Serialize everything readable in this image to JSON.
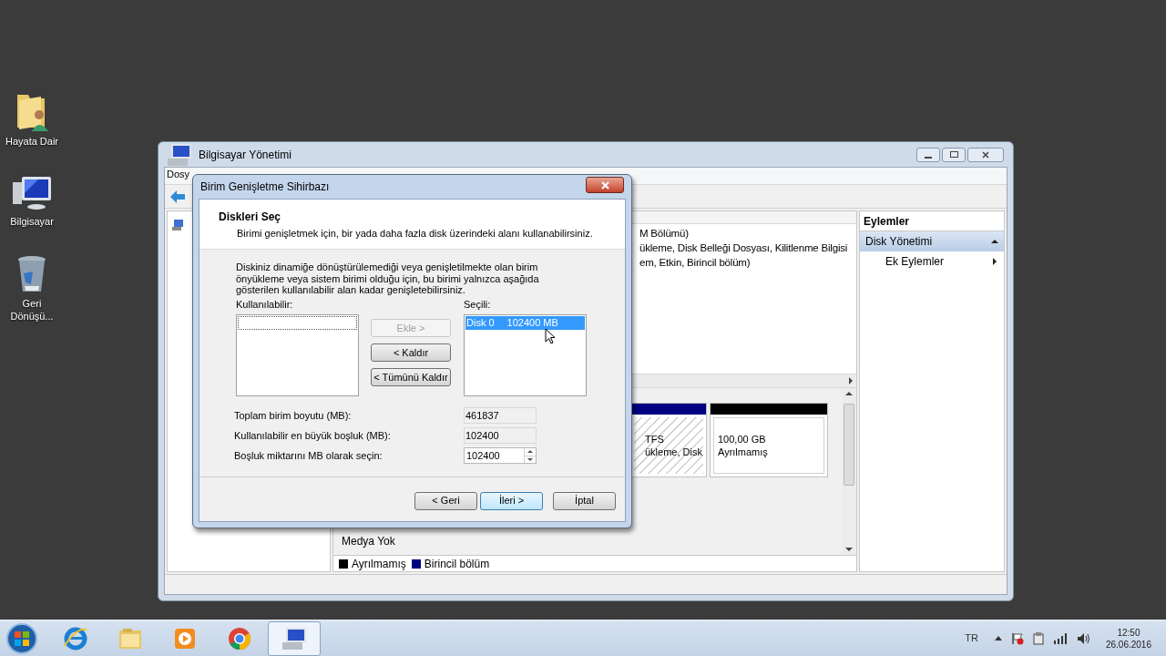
{
  "desktop_icons": [
    {
      "label": "Hayata Dair",
      "kind": "user-folder"
    },
    {
      "label": "Bilgisayar",
      "kind": "computer"
    },
    {
      "label": "Geri Dönüşü...",
      "kind": "recycle-bin"
    }
  ],
  "main_window": {
    "title": "Bilgisayar Yönetimi",
    "menu": [
      "Dosy"
    ],
    "volume_lines": [
      "M Bölümü)",
      "ükleme, Disk Belleği Dosyası, Kilitlenme Bilgisi",
      "em, Etkin, Birincil bölüm)"
    ],
    "partitions": [
      {
        "line1": "TFS",
        "line2": "ükleme, Disk",
        "color": "#000080",
        "kind": "primary"
      },
      {
        "line1": "100,00 GB",
        "line2": "Ayrılmamış",
        "color": "#000000",
        "kind": "unallocated"
      }
    ],
    "disk_rows": [
      {
        "label": "Medya Yok"
      }
    ],
    "legend": [
      {
        "label": "Ayrılmamış",
        "color": "#000000"
      },
      {
        "label": "Birincil bölüm",
        "color": "#000080"
      }
    ],
    "actions": {
      "header": "Eylemler",
      "items": [
        {
          "label": "Disk Yönetimi",
          "kind": "section"
        },
        {
          "label": "Ek Eylemler",
          "kind": "submenu"
        }
      ]
    }
  },
  "dialog": {
    "title": "Birim Genişletme Sihirbazı",
    "heading": "Diskleri Seç",
    "subheading": "Birimi genişletmek için, bir yada daha fazla disk üzerindeki alanı kullanabilirsiniz.",
    "description": "Diskiniz dinamiğe dönüştürülemediği veya genişletilmekte olan birim önyükleme veya sistem birimi olduğu için, bu birimi yalnızca aşağıda gösterilen kullanılabilir alan kadar genişletebilirsiniz.",
    "available_label": "Kullanılabilir:",
    "selected_label": "Seçili:",
    "selected_items": [
      {
        "disk": "Disk 0",
        "size": "102400 MB",
        "selected": true
      }
    ],
    "move_buttons": [
      {
        "label": "Ekle >",
        "disabled": true
      },
      {
        "label": "< Kaldır",
        "disabled": false
      },
      {
        "label": "< Tümünü Kaldır",
        "disabled": false
      }
    ],
    "fields": [
      {
        "label": "Toplam birim boyutu (MB):",
        "value": "461837",
        "kind": "readonly"
      },
      {
        "label": "Kullanılabilir en büyük boşluk (MB):",
        "value": "102400",
        "kind": "readonly"
      },
      {
        "label": "Boşluk miktarını MB olarak seçin:",
        "value": "102400",
        "kind": "spin"
      }
    ],
    "buttons": [
      {
        "label": "< Geri",
        "default": false
      },
      {
        "label": "İleri >",
        "default": true
      },
      {
        "label": "İptal",
        "default": false
      }
    ]
  },
  "taskbar": {
    "apps": [
      {
        "kind": "ie",
        "active": false
      },
      {
        "kind": "explorer",
        "active": false
      },
      {
        "kind": "media",
        "active": false
      },
      {
        "kind": "chrome",
        "active": false
      },
      {
        "kind": "computer-management",
        "active": true
      }
    ],
    "language": "TR",
    "time": "12:50",
    "date": "26.06.2016"
  }
}
